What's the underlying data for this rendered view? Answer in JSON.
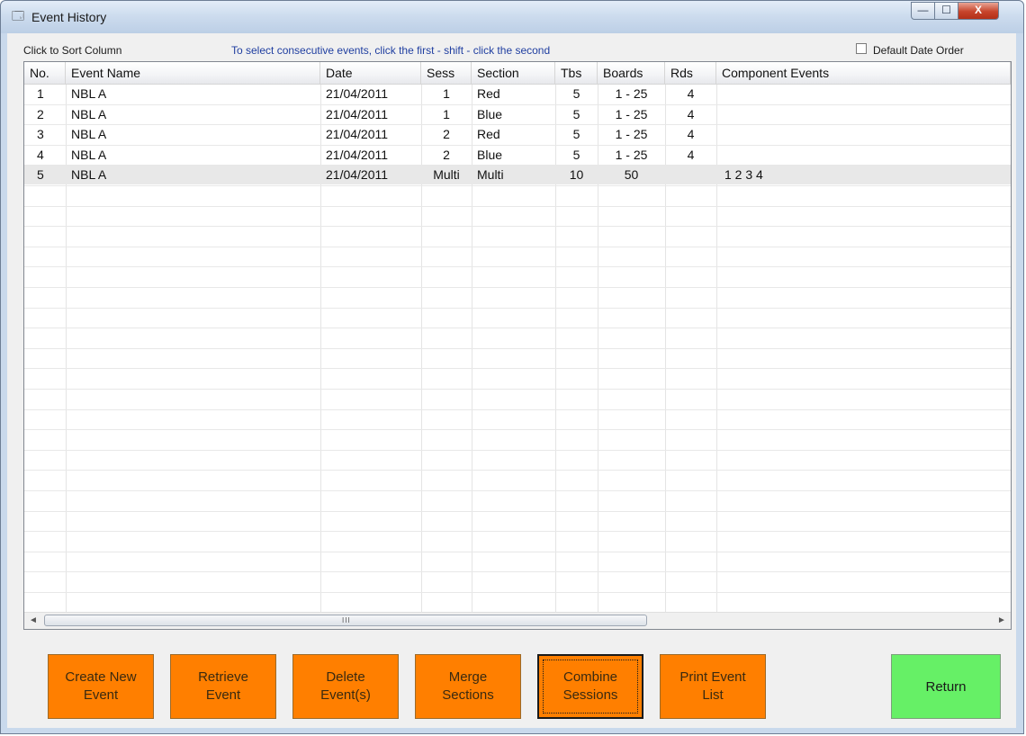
{
  "window": {
    "title": "Event History",
    "controls": {
      "minimize": "—",
      "maximize": "☐",
      "close": "X"
    }
  },
  "toolbar": {
    "sort_hint": "Click to Sort Column",
    "select_hint": "To select consecutive events, click the first - shift - click the second",
    "default_order_label": "Default Date Order",
    "default_order_checked": false
  },
  "table": {
    "columns": [
      "No.",
      "Event Name",
      "Date",
      "Sess",
      "Section",
      "Tbs",
      "Boards",
      "Rds",
      "Component Events"
    ],
    "rows": [
      [
        "1",
        "NBL A",
        "21/04/2011",
        "1",
        "Red",
        "5",
        "1 - 25",
        "4",
        ""
      ],
      [
        "2",
        "NBL A",
        "21/04/2011",
        "1",
        "Blue",
        "5",
        "1 - 25",
        "4",
        ""
      ],
      [
        "3",
        "NBL A",
        "21/04/2011",
        "2",
        "Red",
        "5",
        "1 - 25",
        "4",
        ""
      ],
      [
        "4",
        "NBL A",
        "21/04/2011",
        "2",
        "Blue",
        "5",
        "1 - 25",
        "4",
        ""
      ],
      [
        "5",
        "NBL A",
        "21/04/2011",
        "Multi",
        "Multi",
        "10",
        "50",
        "",
        "1  2  3  4"
      ]
    ],
    "selected_row": 4
  },
  "scrollbar": {
    "grip": "III",
    "left_arrow": "◄",
    "right_arrow": "►"
  },
  "buttons": {
    "create": "Create New\nEvent",
    "retrieve": "Retrieve\nEvent",
    "delete": "Delete\nEvent(s)",
    "merge": "Merge\nSections",
    "combine": "Combine\nSessions",
    "print": "Print Event\nList",
    "return": "Return"
  },
  "colors": {
    "action_button": "#ff7f00",
    "return_button": "#66f066",
    "hint_text": "#1f3ea0"
  }
}
